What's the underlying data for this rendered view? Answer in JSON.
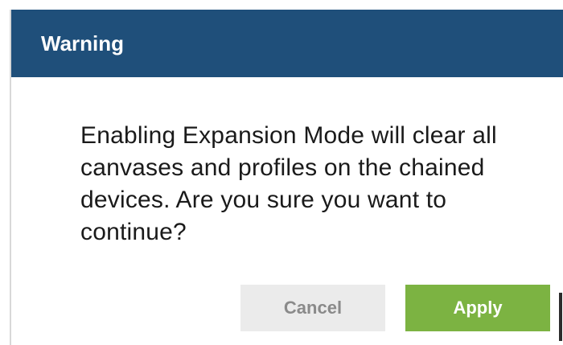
{
  "dialog": {
    "title": "Warning",
    "message": "Enabling Expansion Mode will clear all canvases and  profiles on the chained devices. Are you sure you want to continue?",
    "buttons": {
      "cancel_label": "Cancel",
      "apply_label": "Apply"
    }
  },
  "colors": {
    "header_bg": "#1f4f7a",
    "apply_bg": "#7cb342",
    "cancel_bg": "#ebebeb"
  }
}
